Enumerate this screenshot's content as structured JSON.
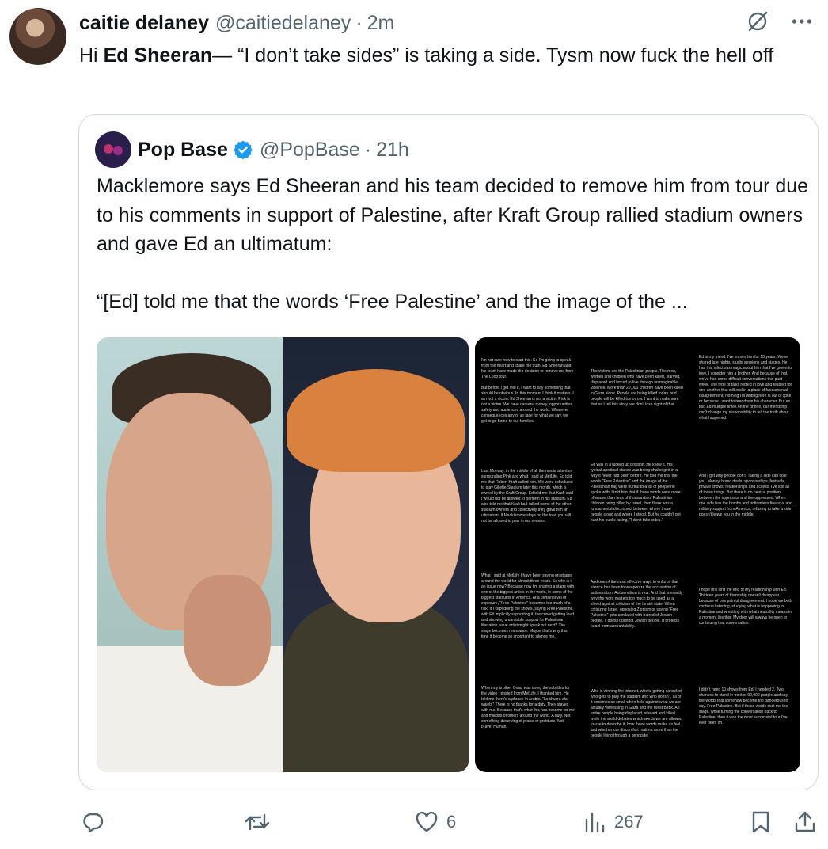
{
  "tweet": {
    "author_name": "caitie delaney",
    "author_handle": "@caitiedelaney",
    "separator": "·",
    "time": "2m",
    "text_prefix": "Hi ",
    "text_bold": "Ed Sheeran",
    "text_suffix": "— “I don’t take sides” is taking a side. Tysm now fuck the hell off"
  },
  "quote": {
    "author_name": "Pop Base",
    "author_handle": "@PopBase",
    "separator": "·",
    "time": "21h",
    "text_para1": "Macklemore says Ed Sheeran and his team decided to remove him from tour due to his comments in support of Palestine, after Kraft Group rallied stadium owners and gave Ed an ultimatum:",
    "text_para2": "“[Ed] told me that the words ‘Free Palestine’ and the image of the ..."
  },
  "letter_columns": [
    {
      "p1": "I'm not sure how to start this. So I'm going to speak from the heart and share the truth. Ed Sheeran and his team have made the decision to remove me from The Loop tour.",
      "p2": "But before I get into it, I want to say something that should be obvious. In this moment I think it matters. I am not a victim. Ed Sheeran is not a victim. Pink is not a victim. We have careers, money, opportunities, safety and audiences around the world. Whatever consequences any of us face for what we say, we get to go home to our families.",
      "p3": "Last Monday, in the middle of all the media attention surrounding Pink and what I said at MetLife, Ed told me that Robert Kraft called him. We were scheduled to play Gillette Stadium later this month, which is owned by the Kraft Group. Ed told me that Kraft said I would not be allowed to perform in his stadium. Ed also told me that Kraft had rallied some of the other stadium owners and collectively they gave him an ultimatum. If Macklemore stays on the tour, you will not be allowed to play in our venues.",
      "p4": "What I said at MetLife I have been saying on stages around the world for almost three years. So why is it an issue now? Because now I'm sharing a stage with one of the biggest artists in the world, in some of the biggest stadiums in America. At a certain level of exposure, \"Free Palestine\" becomes too much of a risk. If I kept doing the shows, saying Free Palestine, with Ed implicitly supporting it, the crowd getting loud and showing undeniable support for Palestinian liberation, what artist might speak out next? The stage becomes resistance. Maybe that's why this time it become so important to silence me.",
      "p5": "When my brother Omar was doing the subtitles for the video I posted from MetLife, I thanked him. He told me there's a phrase in Arabic. \"La shukra ala wajeb.\" There is no thanks for a duty. They stayed with me. Because that's what this has become for me and millions of others around the world. A duty. Not something deserving of praise or gratitude. Not brave. Human."
    },
    {
      "p1": "The victims are the Palestinian people. The men, women and children who have been killed, starved, displaced and forced to live through unimaginable violence. More than 20,000 children have been killed in Gaza alone. People are being killed today, and people will be killed tomorrow. I want to make sure that as I tell this story, we don't lose sight of that.",
      "p2": "Ed was in a fucked up position. He knew it. His typical apolitical stance was being challenged in a way it never had been before. He told me that the words \"Free Palestine\" and the image of the Palestinian flag were hurtful to a lot of people he spoke with. I told him that if those words were more offensive than tens of thousands of Palestinian children being killed by Israel, then there was a fundamental disconnect between where those people stood and where I stood. But he couldn't get past his public facing, \"I don't take sides.\"",
      "p3": "And one of the most effective ways to enforce that silence has been to weaponize the accusation of antisemitism. Antisemitism is real. And that is exactly why the word matters too much to be used as a shield against criticism of the Israeli state. When criticizing Israel, opposing Zionism or saying \"Free Palestine\" gets conflated with hatred of Jewish people, it doesn't protect Jewish people. It protects Israel from accountability.",
      "p4": "Who is winning the internet, who is getting canceled, who gets to play the stadium and who doesn't, all of it becomes so small when held against what we are actually witnessing in Gaza and the West Bank. An entire people being displaced, starved and killed while the world debates which words we are allowed to use to describe it, how those words make us feel, and whether our discomfort matters more than the people living through a genocide."
    },
    {
      "p1": "Ed is my friend. I've known him for 13 years. We've shared late nights, studio sessions and stages. He has this infectious magic about him that I've grown to love. I consider him a brother. And because of that, we've had some difficult conversations this past week. The type of talks rooted in love and respect for one another that still end in a place of fundamental disagreement. Nothing I'm writing here is out of spite or because I want to tear down his character. But as I told Ed multiple times on the phone, our friendship can't change my responsibility to tell the truth about what happened.",
      "p2": "And I get why people don't. Taking a side can cost you. Money, brand deals, sponsorships, festivals, private shows, relationships and access. I've lost all of those things. But there is no neutral position between the oppressor and the oppressed. When one side has the bombs and bottomless financial and military support from America, refusing to take a side doesn't leave you in the middle.",
      "p3": "I hope this isn't the end of my relationship with Ed. Thirteen years of friendship doesn't disappear because of one painful disagreement. I hope we both continue listening, studying what is happening in Palestine and wrestling with what neutrality means in a moment like this. My door will always be open to continuing that conversation.",
      "p4": "I didn't need 10 shows from Ed. I needed 2. Two chances to stand in front of 90,000 people and say the words that somehow become too dangerous to say. Free Palestine. But if those words cost me the stage, while turning the conversation back to Palestine, then it was the most successful tour I've ever been on."
    }
  ],
  "actions": {
    "replies": "",
    "reposts": "",
    "likes": "6",
    "views": "267"
  },
  "icons": [
    "reply-icon",
    "repost-icon",
    "like-icon",
    "views-icon",
    "bookmark-icon",
    "share-icon",
    "grok-icon",
    "more-icon",
    "verified-icon"
  ],
  "colors": {
    "text": "#0f1419",
    "muted": "#536471",
    "border": "#cfd9de",
    "verified": "#1d9bf0"
  }
}
